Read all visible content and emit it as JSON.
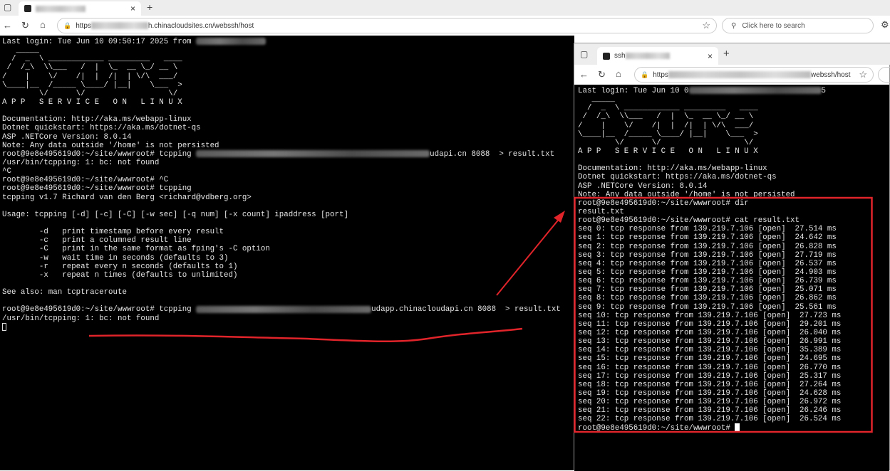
{
  "left_browser": {
    "tab_title": "",
    "new_tab_label": "+",
    "close_tab_label": "×",
    "url_prefix": "https",
    "url_suffix": "h.chinacloudsites.cn/webssh/host",
    "search_placeholder": "Click here to search"
  },
  "right_browser": {
    "tab_title": "ssh",
    "new_tab_label": "+",
    "close_tab_label": "×",
    "url_prefix": "https",
    "url_suffix": "webssh/host"
  },
  "left_terminal": {
    "lines": [
      [
        {
          "t": "Last login: Tue Jun 10 09:50:17 2025 from "
        },
        {
          "r": 1
        }
      ],
      [
        {
          "t": "   _____"
        }
      ],
      [
        {
          "t": "  /  _  \\ ____________ _________   ____"
        }
      ],
      [
        {
          "t": " /  /_\\  \\\\___   /  |  \\_  __ \\_/ __ \\"
        }
      ],
      [
        {
          "t": "/    |    \\/    /|  |  /|  | \\/\\  ___/"
        }
      ],
      [
        {
          "t": "\\____|__  /_____ \\____/ |__|    \\___  >"
        }
      ],
      [
        {
          "t": "        \\/      \\/                  \\/"
        }
      ],
      [
        {
          "t": "A P P   S E R V I C E   O N   L I N U X"
        }
      ],
      [
        {
          "t": ""
        }
      ],
      [
        {
          "t": "Documentation: http://aka.ms/webapp-linux"
        }
      ],
      [
        {
          "t": "Dotnet quickstart: https://aka.ms/dotnet-qs"
        }
      ],
      [
        {
          "t": "ASP .NETCore Version: 8.0.14"
        }
      ],
      [
        {
          "t": "Note: Any data outside '/home' is not persisted"
        }
      ],
      [
        {
          "t": "root@9e8e495619d0:~/site/wwwroot# tcpping "
        },
        {
          "r": 2
        },
        {
          "t": "udapi.cn 8088  > result.txt"
        }
      ],
      [
        {
          "t": "/usr/bin/tcpping: 1: bc: not found"
        }
      ],
      [
        {
          "t": "^C"
        }
      ],
      [
        {
          "t": "root@9e8e495619d0:~/site/wwwroot# ^C"
        }
      ],
      [
        {
          "t": "root@9e8e495619d0:~/site/wwwroot# tcpping"
        }
      ],
      [
        {
          "t": "tcpping v1.7 Richard van den Berg <richard@vdberg.org>"
        }
      ],
      [
        {
          "t": ""
        }
      ],
      [
        {
          "t": "Usage: tcpping [-d] [-c] [-C] [-w sec] [-q num] [-x count] ipaddress [port]"
        }
      ],
      [
        {
          "t": ""
        }
      ],
      [
        {
          "t": "        -d   print timestamp before every result"
        }
      ],
      [
        {
          "t": "        -c   print a columned result line"
        }
      ],
      [
        {
          "t": "        -C   print in the same format as fping's -C option"
        }
      ],
      [
        {
          "t": "        -w   wait time in seconds (defaults to 3)"
        }
      ],
      [
        {
          "t": "        -r   repeat every n seconds (defaults to 1)"
        }
      ],
      [
        {
          "t": "        -x   repeat n times (defaults to unlimited)"
        }
      ],
      [
        {
          "t": ""
        }
      ],
      [
        {
          "t": "See also: man tcptraceroute"
        }
      ],
      [
        {
          "t": ""
        }
      ],
      [
        {
          "t": "root@9e8e495619d0:~/site/wwwroot# tcpping "
        },
        {
          "r": 3
        },
        {
          "t": "udapp.chinacloudapi.cn 8088  > result.txt"
        }
      ],
      [
        {
          "t": "/usr/bin/tcpping: 1: bc: not found"
        }
      ],
      [
        {
          "c": "hollow"
        }
      ]
    ]
  },
  "right_terminal": {
    "lines": [
      [
        {
          "t": "Last login: Tue Jun 10 0"
        },
        {
          "r": 4
        },
        {
          "t": "5"
        }
      ],
      [
        {
          "t": "   _____"
        }
      ],
      [
        {
          "t": "  /  _  \\ ____________ _________   ____"
        }
      ],
      [
        {
          "t": " /  /_\\  \\\\___   /  |  \\_  __ \\_/ __ \\"
        }
      ],
      [
        {
          "t": "/    |    \\/    /|  |  /|  | \\/\\  ___/"
        }
      ],
      [
        {
          "t": "\\____|__  /_____ \\____/ |__|    \\___  >"
        }
      ],
      [
        {
          "t": "        \\/      \\/                  \\/"
        }
      ],
      [
        {
          "t": "A P P   S E R V I C E   O N   L I N U X"
        }
      ],
      [
        {
          "t": ""
        }
      ],
      [
        {
          "t": "Documentation: http://aka.ms/webapp-linux"
        }
      ],
      [
        {
          "t": "Dotnet quickstart: https://aka.ms/dotnet-qs"
        }
      ],
      [
        {
          "t": "ASP .NETCore Version: 8.0.14"
        }
      ],
      [
        {
          "t": "Note: Any data outside '/home' is not persisted"
        }
      ],
      [
        {
          "t": "root@9e8e495619d0:~/site/wwwroot# dir"
        }
      ],
      [
        {
          "t": "result.txt"
        }
      ],
      [
        {
          "t": "root@9e8e495619d0:~/site/wwwroot# cat result.txt"
        }
      ],
      [
        {
          "t": "seq 0: tcp response from 139.219.7.106 [open]  27.514 ms"
        }
      ],
      [
        {
          "t": "seq 1: tcp response from 139.219.7.106 [open]  24.642 ms"
        }
      ],
      [
        {
          "t": "seq 2: tcp response from 139.219.7.106 [open]  26.828 ms"
        }
      ],
      [
        {
          "t": "seq 3: tcp response from 139.219.7.106 [open]  27.719 ms"
        }
      ],
      [
        {
          "t": "seq 4: tcp response from 139.219.7.106 [open]  26.537 ms"
        }
      ],
      [
        {
          "t": "seq 5: tcp response from 139.219.7.106 [open]  24.903 ms"
        }
      ],
      [
        {
          "t": "seq 6: tcp response from 139.219.7.106 [open]  26.739 ms"
        }
      ],
      [
        {
          "t": "seq 7: tcp response from 139.219.7.106 [open]  25.071 ms"
        }
      ],
      [
        {
          "t": "seq 8: tcp response from 139.219.7.106 [open]  26.862 ms"
        }
      ],
      [
        {
          "t": "seq 9: tcp response from 139.219.7.106 [open]  25.561 ms"
        }
      ],
      [
        {
          "t": "seq 10: tcp response from 139.219.7.106 [open]  27.723 ms"
        }
      ],
      [
        {
          "t": "seq 11: tcp response from 139.219.7.106 [open]  29.201 ms"
        }
      ],
      [
        {
          "t": "seq 12: tcp response from 139.219.7.106 [open]  26.040 ms"
        }
      ],
      [
        {
          "t": "seq 13: tcp response from 139.219.7.106 [open]  26.991 ms"
        }
      ],
      [
        {
          "t": "seq 14: tcp response from 139.219.7.106 [open]  35.389 ms"
        }
      ],
      [
        {
          "t": "seq 15: tcp response from 139.219.7.106 [open]  24.695 ms"
        }
      ],
      [
        {
          "t": "seq 16: tcp response from 139.219.7.106 [open]  26.770 ms"
        }
      ],
      [
        {
          "t": "seq 17: tcp response from 139.219.7.106 [open]  25.317 ms"
        }
      ],
      [
        {
          "t": "seq 18: tcp response from 139.219.7.106 [open]  27.264 ms"
        }
      ],
      [
        {
          "t": "seq 19: tcp response from 139.219.7.106 [open]  24.628 ms"
        }
      ],
      [
        {
          "t": "seq 20: tcp response from 139.219.7.106 [open]  26.972 ms"
        }
      ],
      [
        {
          "t": "seq 21: tcp response from 139.219.7.106 [open]  26.246 ms"
        }
      ],
      [
        {
          "t": "seq 22: tcp response from 139.219.7.106 [open]  26.524 ms"
        }
      ],
      [
        {
          "t": "root@9e8e495619d0:~/site/wwwroot# "
        },
        {
          "c": "solid"
        }
      ]
    ]
  },
  "annotation_color": "#e0242a",
  "terminal_bg": "#000000"
}
